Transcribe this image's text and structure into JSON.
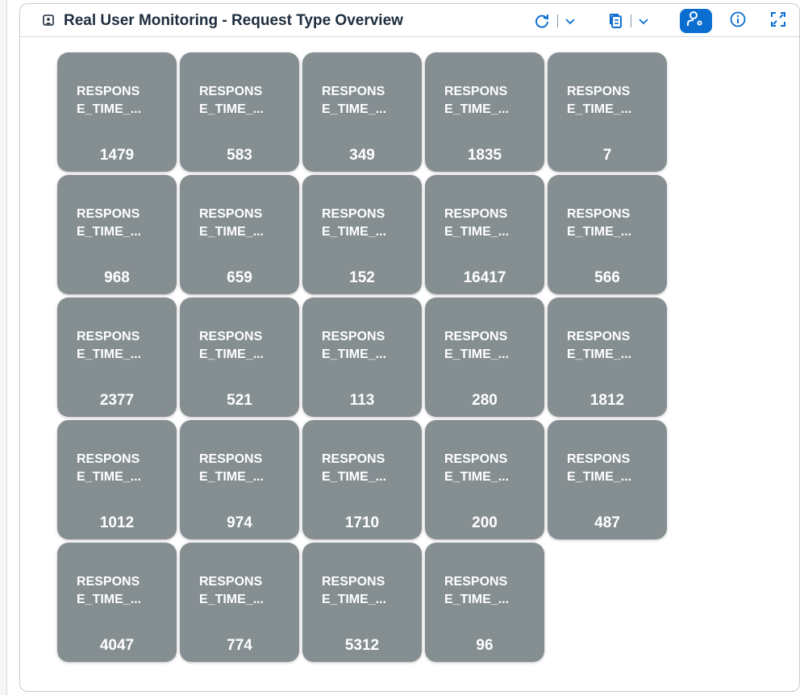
{
  "header": {
    "title": "Real User Monitoring - Request Type Overview",
    "icons": [
      "image-icon",
      "refresh-icon",
      "chevron-down-icon",
      "copy-icon",
      "chevron-down-icon",
      "user-settings-icon",
      "info-icon",
      "fullscreen-icon"
    ]
  },
  "colors": {
    "accent": "#0a6ed1",
    "tile_bg": "#858e91",
    "title_text": "#1d2d3e"
  },
  "tiles": [
    {
      "label": "RESPONS\nE_TIME_...",
      "value": "1479"
    },
    {
      "label": "RESPONS\nE_TIME_...",
      "value": "583"
    },
    {
      "label": "RESPONS\nE_TIME_...",
      "value": "349"
    },
    {
      "label": "RESPONS\nE_TIME_...",
      "value": "1835"
    },
    {
      "label": "RESPONS\nE_TIME_...",
      "value": "7"
    },
    {
      "label": "RESPONS\nE_TIME_...",
      "value": "968"
    },
    {
      "label": "RESPONS\nE_TIME_...",
      "value": "659"
    },
    {
      "label": "RESPONS\nE_TIME_...",
      "value": "152"
    },
    {
      "label": "RESPONS\nE_TIME_...",
      "value": "16417"
    },
    {
      "label": "RESPONS\nE_TIME_...",
      "value": "566"
    },
    {
      "label": "RESPONS\nE_TIME_...",
      "value": "2377"
    },
    {
      "label": "RESPONS\nE_TIME_...",
      "value": "521"
    },
    {
      "label": "RESPONS\nE_TIME_...",
      "value": "113"
    },
    {
      "label": "RESPONS\nE_TIME_...",
      "value": "280"
    },
    {
      "label": "RESPONS\nE_TIME_...",
      "value": "1812"
    },
    {
      "label": "RESPONS\nE_TIME_...",
      "value": "1012"
    },
    {
      "label": "RESPONS\nE_TIME_...",
      "value": "974"
    },
    {
      "label": "RESPONS\nE_TIME_...",
      "value": "1710"
    },
    {
      "label": "RESPONS\nE_TIME_...",
      "value": "200"
    },
    {
      "label": "RESPONS\nE_TIME_...",
      "value": "487"
    },
    {
      "label": "RESPONS\nE_TIME_...",
      "value": "4047"
    },
    {
      "label": "RESPONS\nE_TIME_...",
      "value": "774"
    },
    {
      "label": "RESPONS\nE_TIME_...",
      "value": "5312"
    },
    {
      "label": "RESPONS\nE_TIME_...",
      "value": "96"
    }
  ]
}
